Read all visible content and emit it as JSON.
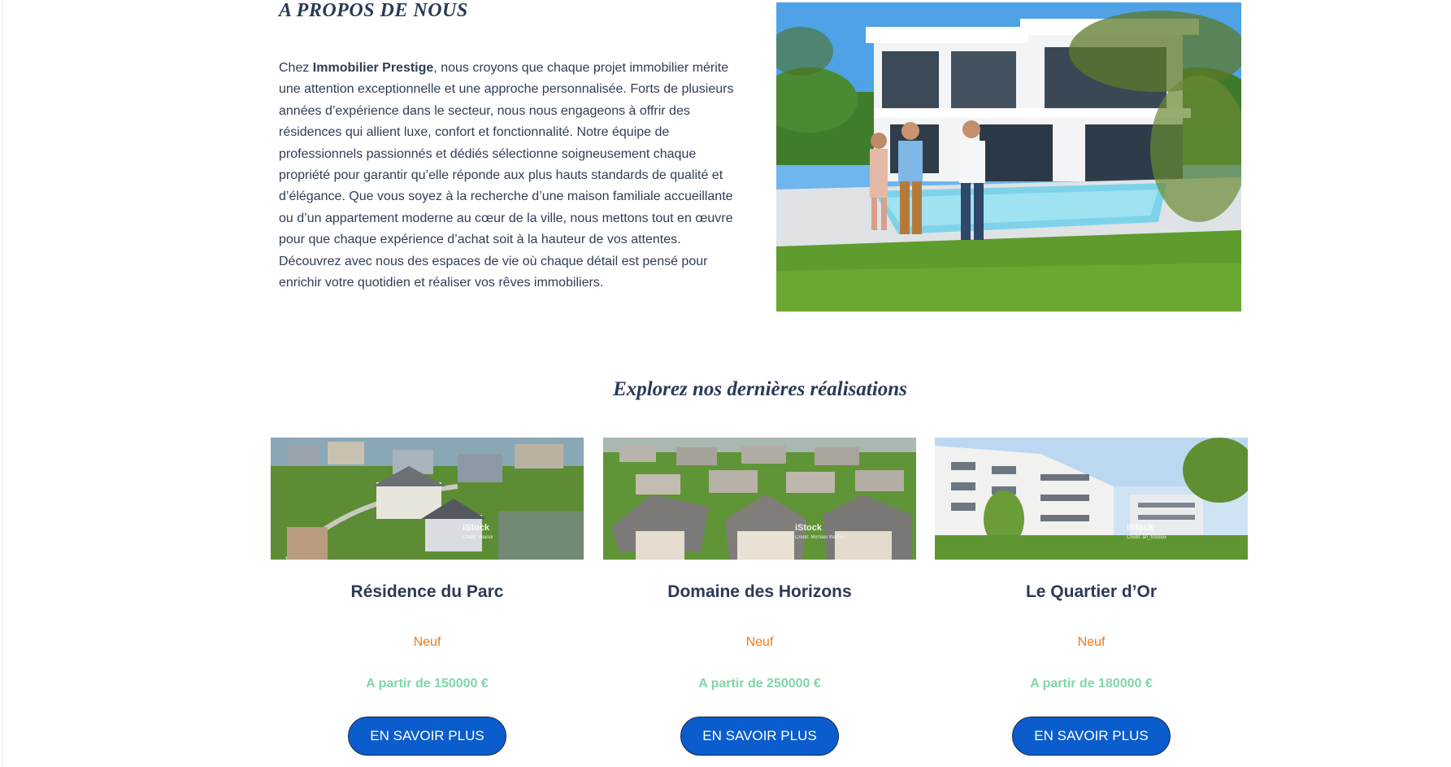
{
  "about": {
    "title": "A PROPOS DE NOUS",
    "intro_prefix": "Chez ",
    "brand": "Immobilier Prestige",
    "intro_body": ", nous croyons que chaque projet immobilier mérite une attention exceptionnelle et une approche personnalisée. Forts de plusieurs années d’expérience dans le secteur, nous nous engageons à offrir des résidences qui allient luxe, confort et fonctionnalité. Notre équipe de professionnels passionnés et dédiés sélectionne soigneusement chaque propriété pour garantir qu’elle réponde aux plus hauts standards de qualité et d’élégance. Que vous soyez à la recherche d’une maison familiale accueillante ou d’un appartement moderne au cœur de la ville, nous mettons tout en œuvre pour que chaque expérience d’achat soit à la hauteur de vos attentes. Découvrez avec nous des espaces de vie où chaque détail est pensé pour enrichir votre quotidien et réaliser vos rêves immobiliers."
  },
  "realisations": {
    "title": "Explorez nos dernières réalisations",
    "cards": [
      {
        "title": "Résidence du Parc",
        "status": "Neuf",
        "price": "A partir de 150000 €",
        "button": "EN SAVOIR PLUS",
        "watermark": "iStock",
        "credit": "Credit: Bilanol"
      },
      {
        "title": "Domaine des Horizons",
        "status": "Neuf",
        "price": "A partir de 250000 €",
        "button": "EN SAVOIR PLUS",
        "watermark": "iStock",
        "credit": "Credit: Michael Warren"
      },
      {
        "title": "Le Quartier d’Or",
        "status": "Neuf",
        "price": "A partir de 180000 €",
        "button": "EN SAVOIR PLUS",
        "watermark": "iStock",
        "credit": "Credit: ah_fotobox"
      }
    ]
  },
  "colors": {
    "heading": "#2b3a55",
    "status": "#f07a1a",
    "price": "#7fd6a8",
    "button": "#0b5ccc"
  }
}
